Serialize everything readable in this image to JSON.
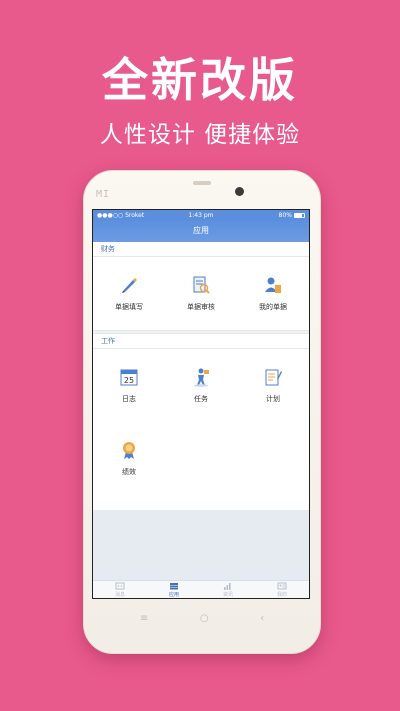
{
  "headline": "全新改版",
  "subline": "人性设计 便捷体验",
  "phone": {
    "brand": "MI"
  },
  "statusbar": {
    "carrier": "●●●○○ Sroket",
    "time": "1:43 pm",
    "battery": "80%"
  },
  "navbar": {
    "title": "应用"
  },
  "sections": [
    {
      "title": "财务",
      "items": [
        {
          "label": "单据填写",
          "icon": "pen-icon"
        },
        {
          "label": "单据审核",
          "icon": "document-search-icon"
        },
        {
          "label": "我的单据",
          "icon": "user-documents-icon"
        }
      ]
    },
    {
      "title": "工作",
      "items": [
        {
          "label": "日志",
          "icon": "calendar-icon",
          "calendar_day": "25"
        },
        {
          "label": "任务",
          "icon": "task-figure-icon"
        },
        {
          "label": "计划",
          "icon": "plan-notepad-icon"
        },
        {
          "label": "绩效",
          "icon": "award-badge-icon"
        }
      ]
    }
  ],
  "tabs": [
    {
      "label": "消息",
      "icon": "message-icon",
      "active": false
    },
    {
      "label": "应用",
      "icon": "apps-stack-icon",
      "active": true
    },
    {
      "label": "资讯",
      "icon": "chart-icon",
      "active": false
    },
    {
      "label": "我的",
      "icon": "profile-card-icon",
      "active": false
    }
  ],
  "softkeys": [
    "≡",
    "○",
    "‹"
  ],
  "colors": {
    "background": "#e95a8c",
    "primary": "#5b8fdd",
    "accent_text": "#4a6fb8"
  }
}
